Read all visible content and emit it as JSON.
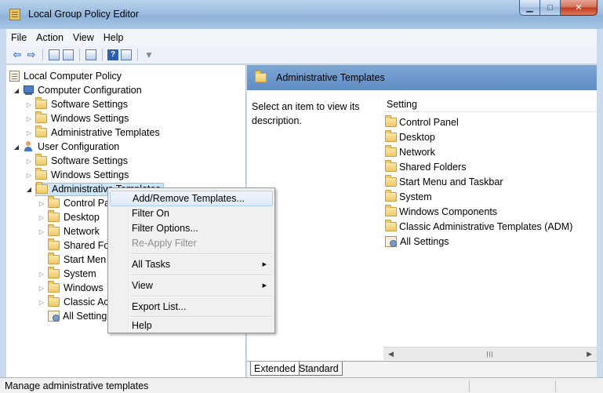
{
  "window": {
    "title": "Local Group Policy Editor"
  },
  "menubar": {
    "items": [
      "File",
      "Action",
      "View",
      "Help"
    ]
  },
  "tree": {
    "root": "Local Computer Policy",
    "computer_config": "Computer Configuration",
    "computer_children": [
      "Software Settings",
      "Windows Settings",
      "Administrative Templates"
    ],
    "user_config": "User Configuration",
    "user_children": [
      "Software Settings",
      "Windows Settings"
    ],
    "selected": "Administrative Templates",
    "admin_children": [
      "Control Pa",
      "Desktop",
      "Network",
      "Shared Fo",
      "Start Men",
      "System",
      "Windows",
      "Classic Ac",
      "All Setting"
    ]
  },
  "right": {
    "header_title": "Administrative Templates",
    "description": "Select an item to view its description.",
    "column_header": "Setting",
    "items": [
      "Control Panel",
      "Desktop",
      "Network",
      "Shared Folders",
      "Start Menu and Taskbar",
      "System",
      "Windows Components",
      "Classic Administrative Templates (ADM)",
      "All Settings"
    ],
    "tabs": [
      "Extended",
      "Standard"
    ]
  },
  "context_menu": {
    "items": [
      "Add/Remove Templates...",
      "Filter On",
      "Filter Options...",
      "Re-Apply Filter",
      "All Tasks",
      "View",
      "Export List...",
      "Help"
    ],
    "hovered": "Add/Remove Templates...",
    "disabled": "Re-Apply Filter"
  },
  "status": {
    "text": "Manage administrative templates"
  }
}
